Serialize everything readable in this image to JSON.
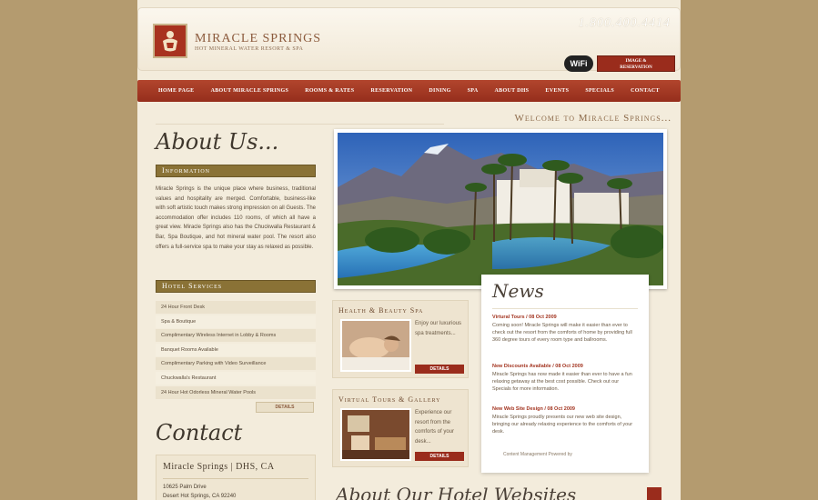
{
  "header": {
    "logo_name": "MIRACLE SPRINGS",
    "logo_subtitle": "HOT MINERAL WATER RESORT & SPA",
    "phone": "1.800.400.4414",
    "wifi_label": "WiFi",
    "booking_label_1": "IMAGE &",
    "booking_label_2": "RESERVATION"
  },
  "nav": {
    "items": [
      "HOME PAGE",
      "ABOUT MIRACLE SPRINGS",
      "ROOMS & RATES",
      "RESERVATION",
      "DINING",
      "SPA",
      "ABOUT DHS",
      "EVENTS",
      "SPECIALS",
      "CONTACT"
    ]
  },
  "welcome": "Welcome to Miracle Springs...",
  "about": {
    "title": "About Us...",
    "info_heading": "Information",
    "info_text": "Miracle Springs is the unique place where business, traditional values and hospitality are merged. Comfortable, business-like with soft artistic touch makes strong impression on all Guests. The accommodation offer includes 110 rooms, of which all have a great view. Miracle Springs also has the Chuckwalla Restaurant & Bar, Spa Boutique, and hot mineral water pool. The resort also offers a full-service spa to make your stay as relaxed as possible."
  },
  "services": {
    "heading": "Hotel Services",
    "items": [
      "24 Hour Front Desk",
      "Spa & Boutique",
      "Complimentary Wireless Internet in Lobby & Rooms",
      "Banquet Rooms Available",
      "Complimentary Parking with Video Surveillance",
      "Chuckwalla's Restaurant",
      "24 Hour Hot Odorless Mineral Water Pools"
    ],
    "details_label": "DETAILS"
  },
  "contact": {
    "title": "Contact",
    "name": "Miracle Springs | DHS, CA",
    "address1": "10625 Palm Drive",
    "address2": "Desert Hot Springs, CA 92240"
  },
  "features": [
    {
      "title": "Health & Beauty Spa",
      "text": "Enjoy our luxurious spa treatments...",
      "button": "DETAILS"
    },
    {
      "title": "Virtual Tours & Gallery",
      "text": "Experience our resort from the comforts of your desk...",
      "button": "DETAILS"
    }
  ],
  "news": {
    "title": "News",
    "items": [
      {
        "title": "Virtural Tours / 08 Oct 2009",
        "body": "Coming soon! Miracle Springs will make it easier than ever to check out the resort from the comforts of home by providing full 360 degree tours of every room type and ballrooms."
      },
      {
        "title": "New Discounts Available / 08 Oct 2009",
        "body": "Miracle Springs has now made it easier than ever to have a fun relaxing getaway at the best cost possible. Check out our Specials for more information."
      },
      {
        "title": "New Web Site Design / 08 Oct 2009",
        "body": "Miracle Springs proudly presents our new web site design, bringing our already relaxing experience to the comforts of your desk."
      }
    ],
    "footer": "Content Management Powered by"
  },
  "bottom_script": "About Our Hotel Websites"
}
